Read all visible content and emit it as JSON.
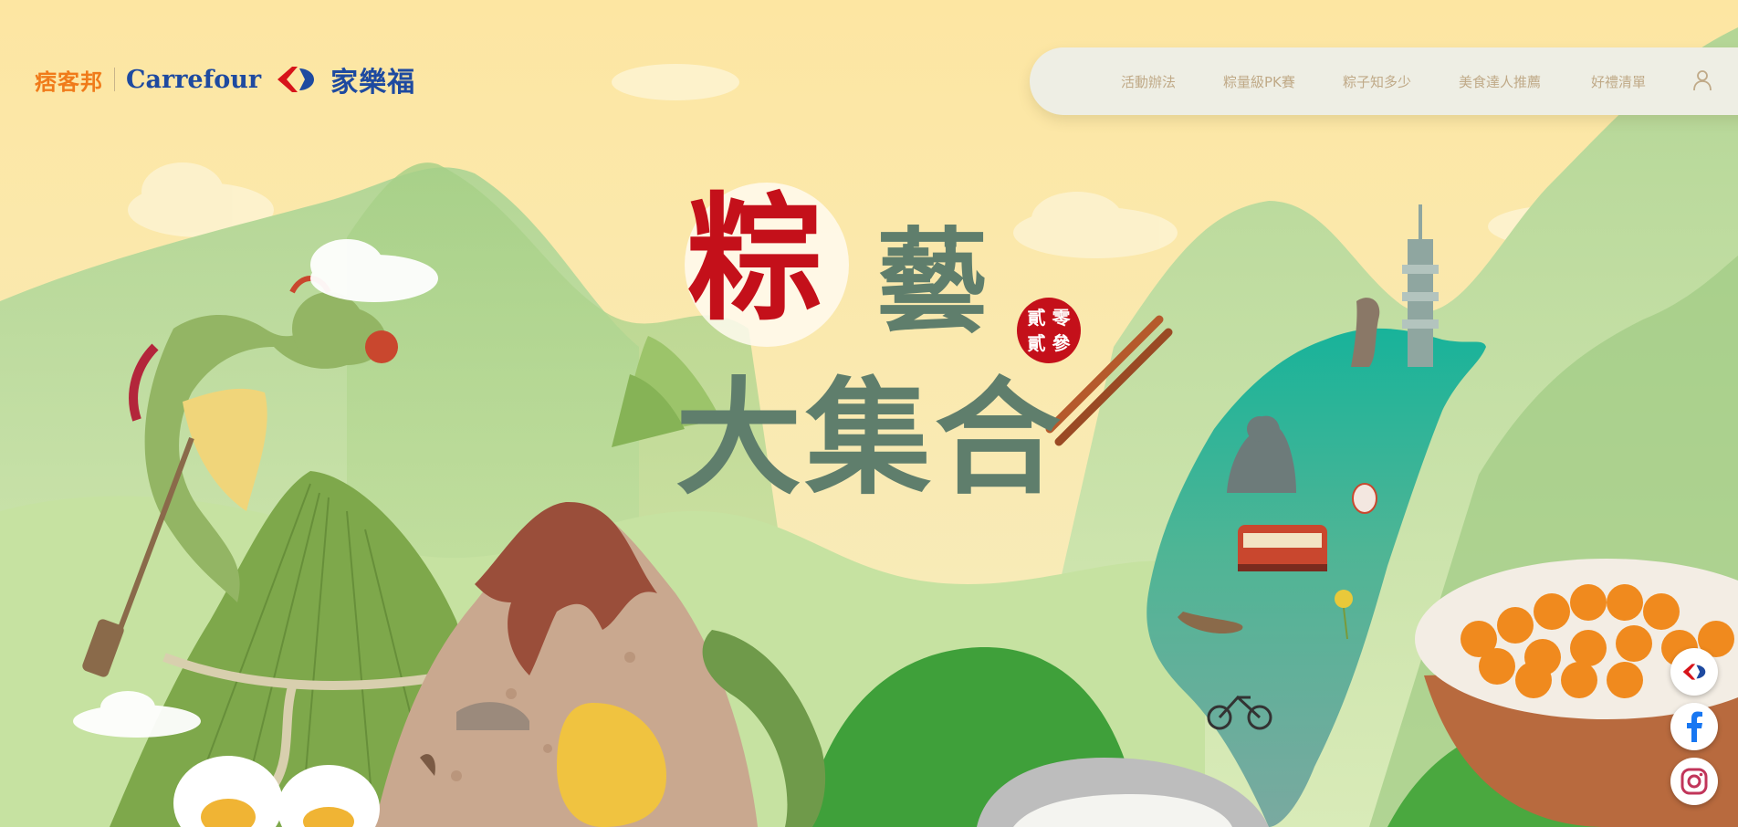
{
  "brand": {
    "pikebon_logo": "痞客邦",
    "carrefour_logo": "Carrefour",
    "jialefu_logo": "家樂福",
    "carrefour_blue": "#1e4aa0",
    "carrefour_red": "#d7141a"
  },
  "nav": {
    "items": [
      {
        "label": "活動辦法"
      },
      {
        "label": "粽量級PK賽"
      },
      {
        "label": "粽子知多少"
      },
      {
        "label": "美食達人推薦"
      },
      {
        "label": "好禮清單"
      }
    ],
    "user_icon": "user-icon"
  },
  "hero": {
    "title_line1_a": "粽",
    "title_line1_b": "藝",
    "title_line2": "大集合",
    "seal": [
      "貳",
      "零",
      "貳",
      "參"
    ],
    "accent_red": "#c4101a",
    "title_green": "#5f7e6c"
  },
  "social": [
    {
      "name": "carrefour",
      "icon": "carrefour-icon"
    },
    {
      "name": "facebook",
      "icon": "facebook-icon"
    },
    {
      "name": "instagram",
      "icon": "instagram-icon"
    }
  ]
}
